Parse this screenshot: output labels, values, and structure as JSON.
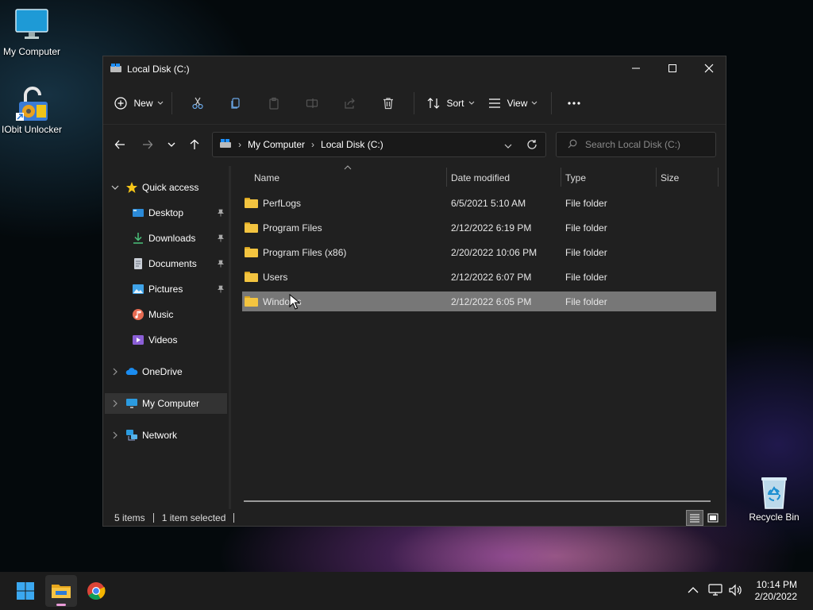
{
  "desktop": {
    "icons": [
      {
        "label": "My Computer",
        "icon": "monitor-icon"
      },
      {
        "label": "IObit Unlocker",
        "icon": "unlocker-icon"
      },
      {
        "label": "Recycle Bin",
        "icon": "recycle-bin-icon"
      }
    ]
  },
  "window": {
    "title": "Local Disk (C:)",
    "controls": [
      "minimize-icon",
      "maximize-icon",
      "close-icon"
    ]
  },
  "toolbar": {
    "new_label": "New",
    "sort_label": "Sort",
    "view_label": "View",
    "icons": [
      "new-icon",
      "cut-icon",
      "copy-icon",
      "paste-icon",
      "rename-icon",
      "share-icon",
      "delete-icon",
      "sort-icon",
      "view-icon",
      "more-icon"
    ]
  },
  "address": {
    "crumbs": [
      "My Computer",
      "Local Disk (C:)"
    ],
    "search_placeholder": "Search Local Disk (C:)"
  },
  "sidebar": {
    "quick_access": "Quick access",
    "items": [
      {
        "label": "Desktop",
        "pinned": true
      },
      {
        "label": "Downloads",
        "pinned": true
      },
      {
        "label": "Documents",
        "pinned": true
      },
      {
        "label": "Pictures",
        "pinned": true
      },
      {
        "label": "Music",
        "pinned": false
      },
      {
        "label": "Videos",
        "pinned": false
      }
    ],
    "onedrive": "OneDrive",
    "mycomputer": "My Computer",
    "network": "Network"
  },
  "columns": {
    "name": "Name",
    "date": "Date modified",
    "type": "Type",
    "size": "Size"
  },
  "files": [
    {
      "name": "PerfLogs",
      "date": "6/5/2021 5:10 AM",
      "type": "File folder",
      "selected": false
    },
    {
      "name": "Program Files",
      "date": "2/12/2022 6:19 PM",
      "type": "File folder",
      "selected": false
    },
    {
      "name": "Program Files (x86)",
      "date": "2/20/2022 10:06 PM",
      "type": "File folder",
      "selected": false
    },
    {
      "name": "Users",
      "date": "2/12/2022 6:07 PM",
      "type": "File folder",
      "selected": false
    },
    {
      "name": "Windows",
      "date": "2/12/2022 6:05 PM",
      "type": "File folder",
      "selected": true
    }
  ],
  "status": {
    "items": "5 items",
    "selected": "1 item selected"
  },
  "taskbar": {
    "apps": [
      "start-icon",
      "file-explorer-icon",
      "chrome-icon"
    ],
    "time": "10:14 PM",
    "date": "2/20/2022"
  },
  "colors": {
    "accent": "#0078d4",
    "selection": "#777777",
    "window_bg": "#202020",
    "folder": "#f3c440"
  }
}
